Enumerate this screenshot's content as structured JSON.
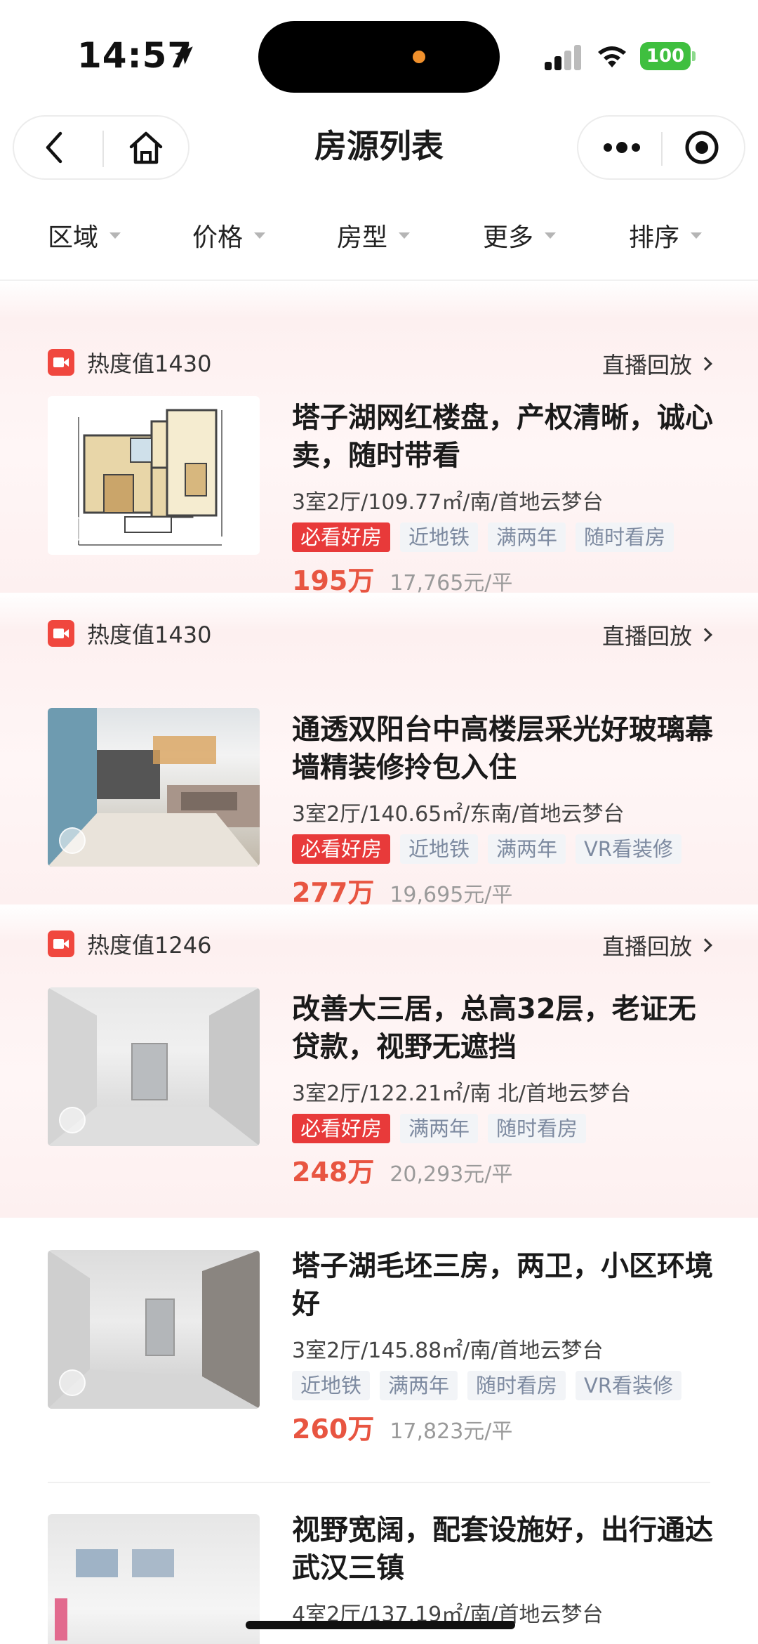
{
  "status_bar": {
    "time": "14:57",
    "battery": "100"
  },
  "nav": {
    "title": "房源列表"
  },
  "filters": [
    {
      "label": "区域"
    },
    {
      "label": "价格"
    },
    {
      "label": "房型"
    },
    {
      "label": "更多"
    },
    {
      "label": "排序"
    }
  ],
  "listings": [
    {
      "heat": "热度值1430",
      "replay": "直播回放",
      "image": "floorplan",
      "title": "塔子湖网红楼盘，产权清晰，诚心卖，随时带看",
      "meta": "3室2厅/109.77㎡/南/首地云梦台",
      "tags": [
        "必看好房",
        "近地铁",
        "满两年",
        "随时看房"
      ],
      "price": "195万",
      "unit_price": "17,765元/平"
    },
    {
      "heat": "热度值1430",
      "replay": "直播回放",
      "image": "room1",
      "title": "通透双阳台中高楼层采光好玻璃幕墙精装修拎包入住",
      "meta": "3室2厅/140.65㎡/东南/首地云梦台",
      "tags": [
        "必看好房",
        "近地铁",
        "满两年",
        "VR看装修"
      ],
      "price": "277万",
      "unit_price": "19,695元/平"
    },
    {
      "heat": "热度值1246",
      "replay": "直播回放",
      "image": "room2",
      "title": "改善大三居，总高32层，老证无贷款，视野无遮挡",
      "meta": "3室2厅/122.21㎡/南 北/首地云梦台",
      "tags": [
        "必看好房",
        "满两年",
        "随时看房"
      ],
      "price": "248万",
      "unit_price": "20,293元/平"
    },
    {
      "image": "room3",
      "title": "塔子湖毛坯三房，两卫，小区环境好",
      "meta": "3室2厅/145.88㎡/南/首地云梦台",
      "tags": [
        "近地铁",
        "满两年",
        "随时看房",
        "VR看装修"
      ],
      "price": "260万",
      "unit_price": "17,823元/平"
    },
    {
      "image": "room4",
      "title": "视野宽阔，配套设施好，出行通达武汉三镇",
      "meta": "4室2厅/137.19㎡/南/首地云梦台"
    }
  ]
}
